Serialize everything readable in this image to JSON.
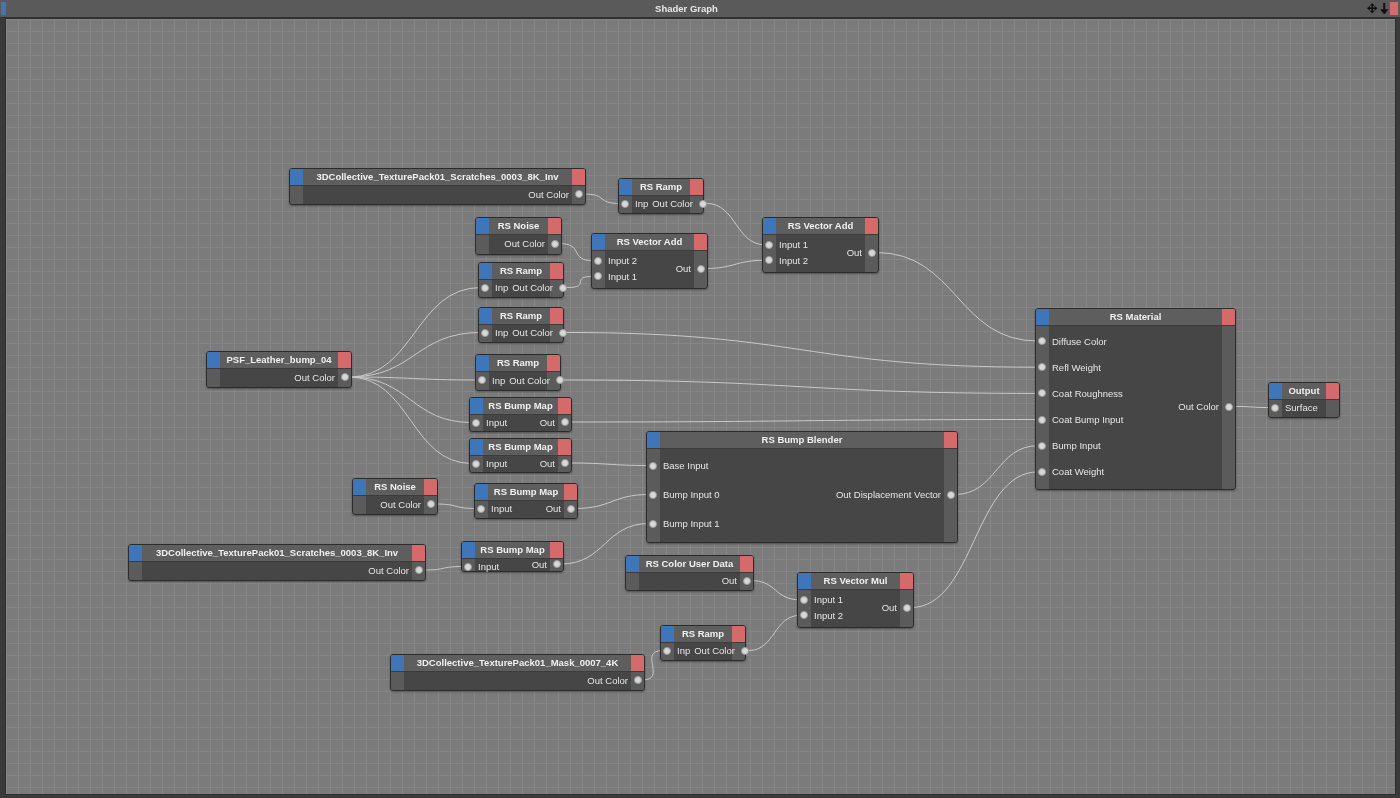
{
  "window": {
    "title": "Shader Graph"
  },
  "nodes": [
    {
      "title": "3DCollective_TexturePack01_Scratches_0003_8K_Inv",
      "outputs": [
        "Out Color"
      ]
    },
    {
      "title": "RS Ramp",
      "inputs": [
        "Inp"
      ],
      "outputs": [
        "Out Color"
      ]
    },
    {
      "title": "RS Noise",
      "outputs": [
        "Out Color"
      ]
    },
    {
      "title": "RS Vector Add",
      "inputs": [
        "Input 2",
        "Input 1"
      ],
      "outputs": [
        "Out"
      ]
    },
    {
      "title": "RS Vector Add",
      "inputs": [
        "Input 1",
        "Input 2"
      ],
      "outputs": [
        "Out"
      ]
    },
    {
      "title": "RS Ramp",
      "inputs": [
        "Inp"
      ],
      "outputs": [
        "Out Color"
      ]
    },
    {
      "title": "RS Ramp",
      "inputs": [
        "Inp"
      ],
      "outputs": [
        "Out Color"
      ]
    },
    {
      "title": "RS Material",
      "inputs": [
        "Diffuse Color",
        "Refl Weight",
        "Coat Roughness",
        "Coat Bump Input",
        "Bump Input",
        "Coat Weight"
      ],
      "outputs": [
        "Out Color"
      ]
    },
    {
      "title": "PSF_Leather_bump_04",
      "outputs": [
        "Out Color"
      ]
    },
    {
      "title": "RS Ramp",
      "inputs": [
        "Inp"
      ],
      "outputs": [
        "Out Color"
      ]
    },
    {
      "title": "Output",
      "inputs": [
        "Surface"
      ]
    },
    {
      "title": "RS Bump Map",
      "inputs": [
        "Input"
      ],
      "outputs": [
        "Out"
      ]
    },
    {
      "title": "RS Bump Blender",
      "inputs": [
        "Base Input",
        "Bump Input 0",
        "Bump Input 1"
      ],
      "outputs": [
        "Out Displacement Vector"
      ]
    },
    {
      "title": "RS Bump Map",
      "inputs": [
        "Input"
      ],
      "outputs": [
        "Out"
      ]
    },
    {
      "title": "RS Noise",
      "outputs": [
        "Out Color"
      ]
    },
    {
      "title": "RS Bump Map",
      "inputs": [
        "Input"
      ],
      "outputs": [
        "Out"
      ]
    },
    {
      "title": "3DCollective_TexturePack01_Scratches_0003_8K_Inv",
      "outputs": [
        "Out Color"
      ]
    },
    {
      "title": "RS Bump Map",
      "inputs": [
        "Input"
      ],
      "outputs": [
        "Out"
      ]
    },
    {
      "title": "RS Color User Data",
      "outputs": [
        "Out"
      ]
    },
    {
      "title": "RS Vector Mul",
      "inputs": [
        "Input 1",
        "Input 2"
      ],
      "outputs": [
        "Out"
      ]
    },
    {
      "title": "RS Ramp",
      "inputs": [
        "Inp"
      ],
      "outputs": [
        "Out Color"
      ]
    },
    {
      "title": "3DCollective_TexturePack01_Mask_0007_4K",
      "outputs": [
        "Out Color"
      ]
    }
  ]
}
